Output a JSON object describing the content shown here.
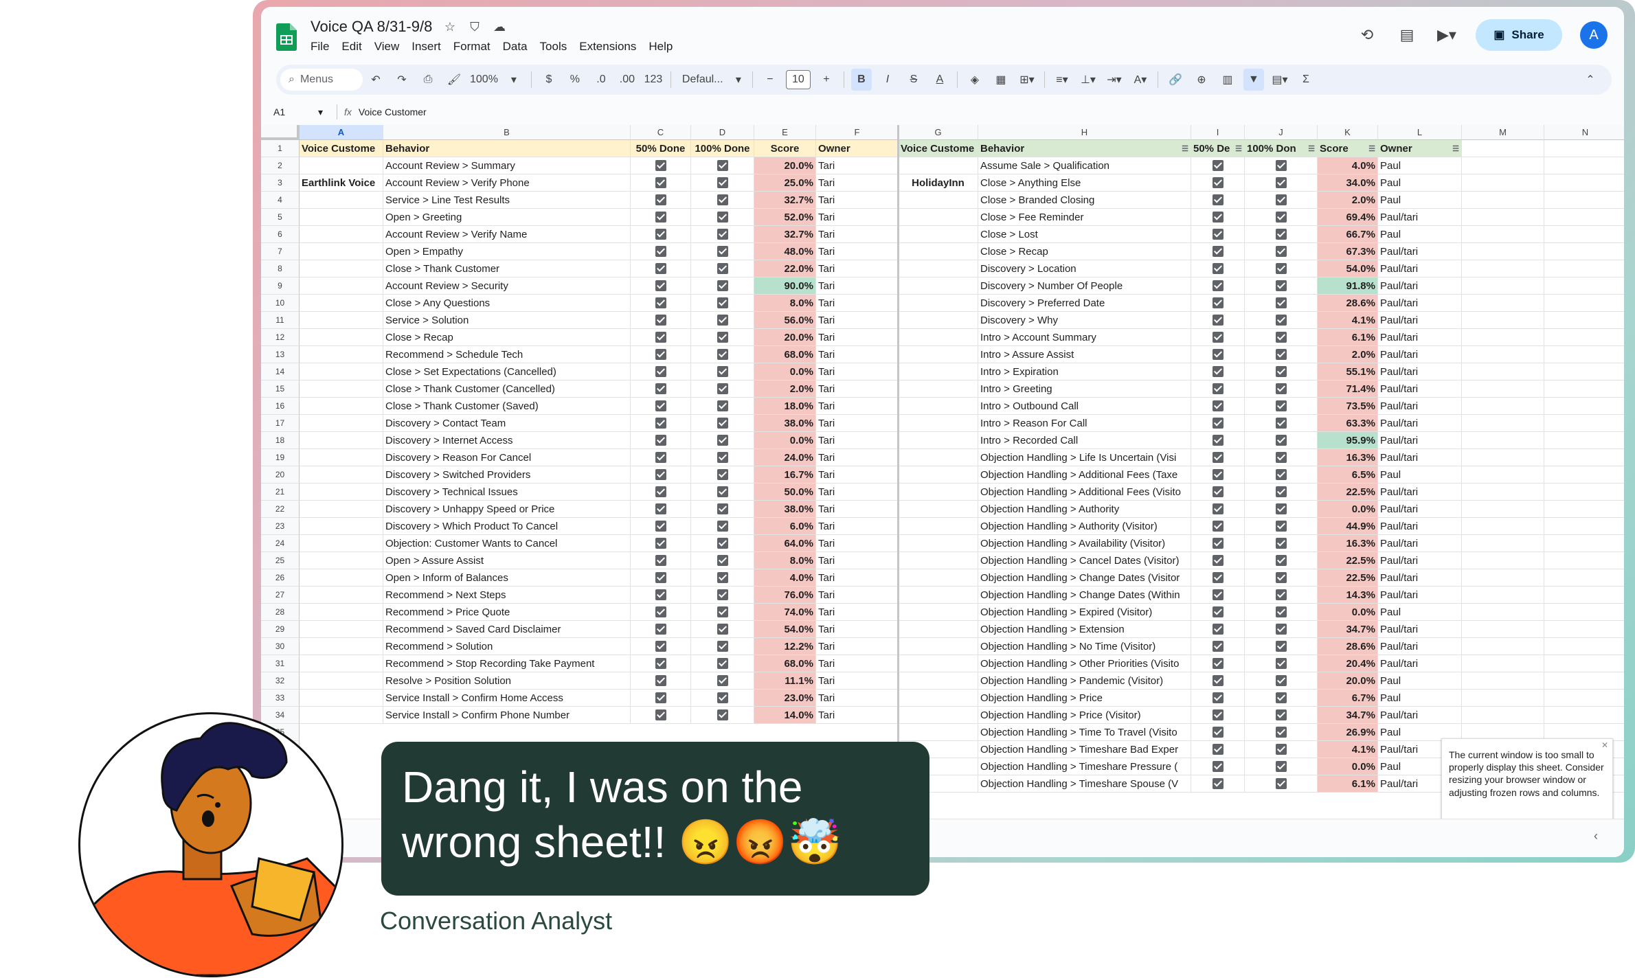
{
  "doc": {
    "title": "Voice QA 8/31-9/8",
    "menu": [
      "File",
      "Edit",
      "View",
      "Insert",
      "Format",
      "Data",
      "Tools",
      "Extensions",
      "Help"
    ],
    "share_label": "Share",
    "avatar_letter": "A"
  },
  "toolbar": {
    "search_label": "Menus",
    "zoom": "100%",
    "currency": "$",
    "percent": "%",
    "dec_less": ".0",
    "dec_more": ".00",
    "number_format": "123",
    "font": "Defaul...",
    "font_size": "10"
  },
  "formula_bar": {
    "cell_ref": "A1",
    "content": "Voice Customer"
  },
  "columns": [
    "A",
    "B",
    "C",
    "D",
    "E",
    "F",
    "G",
    "H",
    "I",
    "J",
    "K",
    "L",
    "M",
    "N"
  ],
  "left_table": {
    "headers": [
      "Voice Custome",
      "Behavior",
      "50% Done",
      "100% Done",
      "Score",
      "Owner"
    ],
    "customer_label": "Earthlink Voice",
    "rows": [
      [
        "Account Review > Summary",
        "20.0%",
        "Tari"
      ],
      [
        "Account Review > Verify Phone",
        "25.0%",
        "Tari"
      ],
      [
        "Service > Line Test Results",
        "32.7%",
        "Tari"
      ],
      [
        "Open > Greeting",
        "52.0%",
        "Tari"
      ],
      [
        "Account Review > Verify Name",
        "32.7%",
        "Tari"
      ],
      [
        "Open > Empathy",
        "48.0%",
        "Tari"
      ],
      [
        "Close > Thank Customer",
        "22.0%",
        "Tari"
      ],
      [
        "Account Review > Security",
        "90.0%",
        "Tari"
      ],
      [
        "Close > Any Questions",
        "8.0%",
        "Tari"
      ],
      [
        "Service > Solution",
        "56.0%",
        "Tari"
      ],
      [
        "Close > Recap",
        "20.0%",
        "Tari"
      ],
      [
        "Recommend > Schedule Tech",
        "68.0%",
        "Tari"
      ],
      [
        "Close > Set Expectations (Cancelled)",
        "0.0%",
        "Tari"
      ],
      [
        "Close > Thank Customer (Cancelled)",
        "2.0%",
        "Tari"
      ],
      [
        "Close > Thank Customer (Saved)",
        "18.0%",
        "Tari"
      ],
      [
        "Discovery > Contact Team",
        "38.0%",
        "Tari"
      ],
      [
        "Discovery > Internet Access",
        "0.0%",
        "Tari"
      ],
      [
        "Discovery > Reason For Cancel",
        "24.0%",
        "Tari"
      ],
      [
        "Discovery > Switched Providers",
        "16.7%",
        "Tari"
      ],
      [
        "Discovery > Technical Issues",
        "50.0%",
        "Tari"
      ],
      [
        "Discovery > Unhappy Speed or Price",
        "38.0%",
        "Tari"
      ],
      [
        "Discovery > Which Product To Cancel",
        "6.0%",
        "Tari"
      ],
      [
        "Objection: Customer Wants to Cancel",
        "64.0%",
        "Tari"
      ],
      [
        "Open > Assure Assist",
        "8.0%",
        "Tari"
      ],
      [
        "Open > Inform of Balances",
        "4.0%",
        "Tari"
      ],
      [
        "Recommend > Next Steps",
        "76.0%",
        "Tari"
      ],
      [
        "Recommend > Price Quote",
        "74.0%",
        "Tari"
      ],
      [
        "Recommend > Saved Card Disclaimer",
        "54.0%",
        "Tari"
      ],
      [
        "Recommend > Solution",
        "12.2%",
        "Tari"
      ],
      [
        "Recommend > Stop Recording Take Payment",
        "68.0%",
        "Tari"
      ],
      [
        "Resolve > Position Solution",
        "11.1%",
        "Tari"
      ],
      [
        "Service Install > Confirm Home Access",
        "23.0%",
        "Tari"
      ],
      [
        "Service Install > Confirm Phone Number",
        "14.0%",
        "Tari"
      ]
    ]
  },
  "right_table": {
    "headers": [
      "Voice Custome",
      "Behavior",
      "50% De",
      "100% Don",
      "Score",
      "Owner"
    ],
    "customer_label": "HolidayInn",
    "rows": [
      [
        "Assume Sale > Qualification",
        "4.0%",
        "Paul"
      ],
      [
        "Close > Anything Else",
        "34.0%",
        "Paul"
      ],
      [
        "Close > Branded Closing",
        "2.0%",
        "Paul"
      ],
      [
        "Close > Fee Reminder",
        "69.4%",
        "Paul/tari"
      ],
      [
        "Close > Lost",
        "66.7%",
        "Paul"
      ],
      [
        "Close > Recap",
        "67.3%",
        "Paul/tari"
      ],
      [
        "Discovery > Location",
        "54.0%",
        "Paul/tari"
      ],
      [
        "Discovery > Number Of People",
        "91.8%",
        "Paul/tari"
      ],
      [
        "Discovery > Preferred Date",
        "28.6%",
        "Paul/tari"
      ],
      [
        "Discovery > Why",
        "4.1%",
        "Paul/tari"
      ],
      [
        "Intro > Account Summary",
        "6.1%",
        "Paul/tari"
      ],
      [
        "Intro > Assure Assist",
        "2.0%",
        "Paul/tari"
      ],
      [
        "Intro > Expiration",
        "55.1%",
        "Paul/tari"
      ],
      [
        "Intro > Greeting",
        "71.4%",
        "Paul/tari"
      ],
      [
        "Intro > Outbound Call",
        "73.5%",
        "Paul/tari"
      ],
      [
        "Intro > Reason For Call",
        "63.3%",
        "Paul/tari"
      ],
      [
        "Intro > Recorded Call",
        "95.9%",
        "Paul/tari"
      ],
      [
        "Objection Handling >  Life Is Uncertain (Visi",
        "16.3%",
        "Paul/tari"
      ],
      [
        "Objection Handling > Additional Fees (Taxe",
        "6.5%",
        "Paul"
      ],
      [
        "Objection Handling > Additional Fees (Visito",
        "22.5%",
        "Paul/tari"
      ],
      [
        "Objection Handling > Authority",
        "0.0%",
        "Paul/tari"
      ],
      [
        "Objection Handling > Authority (Visitor)",
        "44.9%",
        "Paul/tari"
      ],
      [
        "Objection Handling > Availability (Visitor)",
        "16.3%",
        "Paul/tari"
      ],
      [
        "Objection Handling > Cancel Dates (Visitor)",
        "22.5%",
        "Paul/tari"
      ],
      [
        "Objection Handling > Change Dates (Visitor",
        "22.5%",
        "Paul/tari"
      ],
      [
        "Objection Handling > Change Dates (Within",
        "14.3%",
        "Paul/tari"
      ],
      [
        "Objection Handling > Expired (Visitor)",
        "0.0%",
        "Paul"
      ],
      [
        "Objection Handling > Extension",
        "34.7%",
        "Paul/tari"
      ],
      [
        "Objection Handling > No Time (Visitor)",
        "28.6%",
        "Paul/tari"
      ],
      [
        "Objection Handling > Other Priorities (Visito",
        "20.4%",
        "Paul/tari"
      ],
      [
        "Objection Handling > Pandemic (Visitor)",
        "20.0%",
        "Paul"
      ],
      [
        "Objection Handling > Price",
        "6.7%",
        "Paul"
      ],
      [
        "Objection Handling > Price (Visitor)",
        "34.7%",
        "Paul/tari"
      ],
      [
        "Objection Handling > Time To Travel (Visito",
        "26.9%",
        "Paul"
      ],
      [
        "Objection Handling > Timeshare Bad Exper",
        "4.1%",
        "Paul/tari"
      ],
      [
        "Objection Handling > Timeshare Pressure (",
        "0.0%",
        "Paul"
      ],
      [
        "Objection Handling > Timeshare Spouse (V",
        "6.1%",
        "Paul/tari"
      ]
    ]
  },
  "toast_text": "The current window is too small to properly display this sheet. Consider resizing your browser window or adjusting frozen rows and columns.",
  "overlay": {
    "bubble_line1": "Dang it, I was on the",
    "bubble_line2": "wrong sheet!! 😠😡🤯",
    "caption": "Conversation Analyst"
  },
  "colors": {
    "score_red": "#f4c7c3",
    "score_green": "#b7e1cd",
    "header_yellow": "#fff2cc",
    "header_green": "#d9ead3"
  }
}
